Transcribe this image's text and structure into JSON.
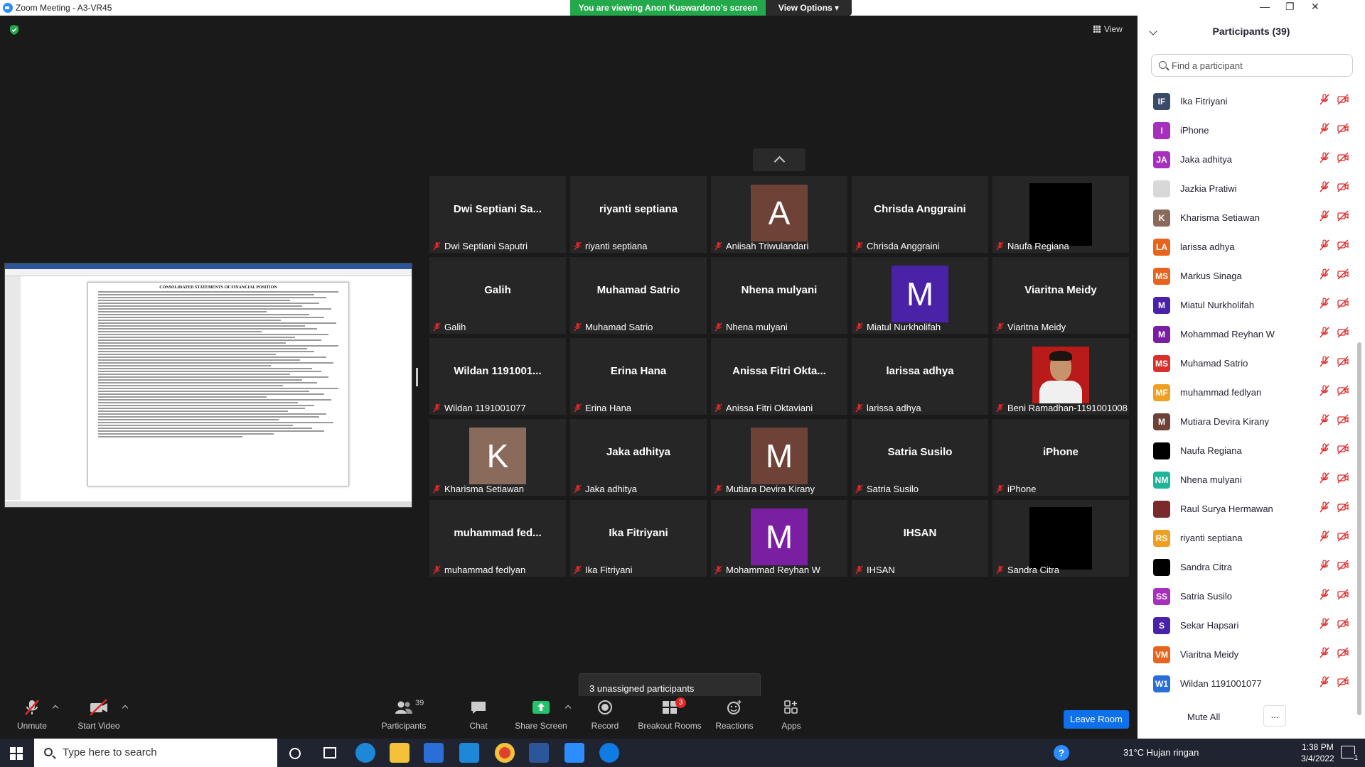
{
  "window": {
    "title": "Zoom Meeting - A3-VR45",
    "banner": "You are viewing Anon Kuswardono's screen",
    "view_options": "View Options",
    "view_label": "View"
  },
  "shared_screen": {
    "slide_title": "CONSOLIDATED STATEMENTS OF FINANCIAL POSITION"
  },
  "tiles": [
    {
      "big": "Dwi Septiani Sa...",
      "name": "Dwi Septiani Saputri",
      "type": "text"
    },
    {
      "big": "riyanti septiana",
      "name": "riyanti septiana",
      "type": "text"
    },
    {
      "big": "A",
      "name": "Aniisah Triwulandari",
      "type": "avatar",
      "color": "#6e4237"
    },
    {
      "big": "Chrisda Anggraini",
      "name": "Chrisda Anggraini",
      "type": "text"
    },
    {
      "big": "",
      "name": "Naufa Regiana",
      "type": "black"
    },
    {
      "big": "Galih",
      "name": "Galih",
      "type": "text"
    },
    {
      "big": "Muhamad Satrio",
      "name": "Muhamad Satrio",
      "type": "text"
    },
    {
      "big": "Nhena mulyani",
      "name": "Nhena mulyani",
      "type": "text"
    },
    {
      "big": "M",
      "name": "Miatul Nurkholifah",
      "type": "avatar",
      "color": "#4a22a8"
    },
    {
      "big": "Viaritna Meidy",
      "name": "Viaritna Meidy",
      "type": "text"
    },
    {
      "big": "Wildan 1191001...",
      "name": "Wildan 1191001077",
      "type": "text"
    },
    {
      "big": "Erina Hana",
      "name": "Erina Hana",
      "type": "text"
    },
    {
      "big": "Anissa Fitri Okta...",
      "name": "Anissa Fitri Oktaviani",
      "type": "text"
    },
    {
      "big": "larissa adhya",
      "name": "larissa adhya",
      "type": "text"
    },
    {
      "big": "",
      "name": "Beni Ramadhan-1191001008",
      "type": "photo"
    },
    {
      "big": "K",
      "name": "Kharisma Setiawan",
      "type": "avatar",
      "color": "#8a6a5a"
    },
    {
      "big": "Jaka adhitya",
      "name": "Jaka adhitya",
      "type": "text"
    },
    {
      "big": "M",
      "name": "Mutiara Devira Kirany",
      "type": "avatar",
      "color": "#6e4237"
    },
    {
      "big": "Satria Susilo",
      "name": "Satria Susilo",
      "type": "text"
    },
    {
      "big": "iPhone",
      "name": "iPhone",
      "type": "text"
    },
    {
      "big": "muhammad  fed...",
      "name": "muhammad fedlyan",
      "type": "text"
    },
    {
      "big": "Ika Fitriyani",
      "name": "Ika Fitriyani",
      "type": "text"
    },
    {
      "big": "M",
      "name": "Mohammad Reyhan W",
      "type": "avatar",
      "color": "#7a1fa2"
    },
    {
      "big": "IHSAN",
      "name": "IHSAN",
      "type": "text"
    },
    {
      "big": "",
      "name": "Sandra Citra",
      "type": "black"
    }
  ],
  "unassigned": "3 unassigned participants",
  "toolbar": {
    "unmute": "Unmute",
    "start_video": "Start Video",
    "participants": "Participants",
    "participants_count": "39",
    "chat": "Chat",
    "share_screen": "Share Screen",
    "record": "Record",
    "breakout_rooms": "Breakout Rooms",
    "breakout_badge": "3",
    "reactions": "Reactions",
    "apps": "Apps",
    "leave_room": "Leave Room"
  },
  "panel": {
    "title": "Participants (39)",
    "search_placeholder": "Find a participant",
    "mute_all": "Mute All",
    "more": "...",
    "participants": [
      {
        "initials": "IF",
        "name": "Ika Fitriyani",
        "color": "#3a4a6b"
      },
      {
        "initials": "I",
        "name": "iPhone",
        "color": "#a62fbd"
      },
      {
        "initials": "JA",
        "name": "Jaka adhitya",
        "color": "#a62fbd"
      },
      {
        "initials": "",
        "name": "Jazkia Pratiwi",
        "color": "#d8d8d8"
      },
      {
        "initials": "K",
        "name": "Kharisma Setiawan",
        "color": "#8a6a5a"
      },
      {
        "initials": "LA",
        "name": "larissa adhya",
        "color": "#e8641c"
      },
      {
        "initials": "MS",
        "name": "Markus Sinaga",
        "color": "#e8641c"
      },
      {
        "initials": "M",
        "name": "Miatul Nurkholifah",
        "color": "#4a22a8"
      },
      {
        "initials": "M",
        "name": "Mohammad Reyhan W",
        "color": "#7a1fa2"
      },
      {
        "initials": "MS",
        "name": "Muhamad Satrio",
        "color": "#d9302c"
      },
      {
        "initials": "MF",
        "name": "muhammad fedlyan",
        "color": "#f0a020"
      },
      {
        "initials": "M",
        "name": "Mutiara Devira Kirany",
        "color": "#6e4237"
      },
      {
        "initials": "",
        "name": "Naufa Regiana",
        "color": "#000000"
      },
      {
        "initials": "NM",
        "name": "Nhena mulyani",
        "color": "#1fb59c"
      },
      {
        "initials": "",
        "name": "Raul Surya Hermawan",
        "color": "#7a2a2a"
      },
      {
        "initials": "RS",
        "name": "riyanti septiana",
        "color": "#f0a020"
      },
      {
        "initials": "",
        "name": "Sandra Citra",
        "color": "#000000"
      },
      {
        "initials": "SS",
        "name": "Satria Susilo",
        "color": "#a62fbd"
      },
      {
        "initials": "S",
        "name": "Sekar Hapsari",
        "color": "#4a22a8"
      },
      {
        "initials": "VM",
        "name": "Viaritna Meidy",
        "color": "#e8641c"
      },
      {
        "initials": "W1",
        "name": "Wildan 1191001077",
        "color": "#2a6ed8"
      }
    ]
  },
  "taskbar": {
    "search_placeholder": "Type here to search",
    "weather": "31°C  Hujan ringan",
    "time": "1:38 PM",
    "date": "3/4/2022",
    "notifications": "1"
  }
}
